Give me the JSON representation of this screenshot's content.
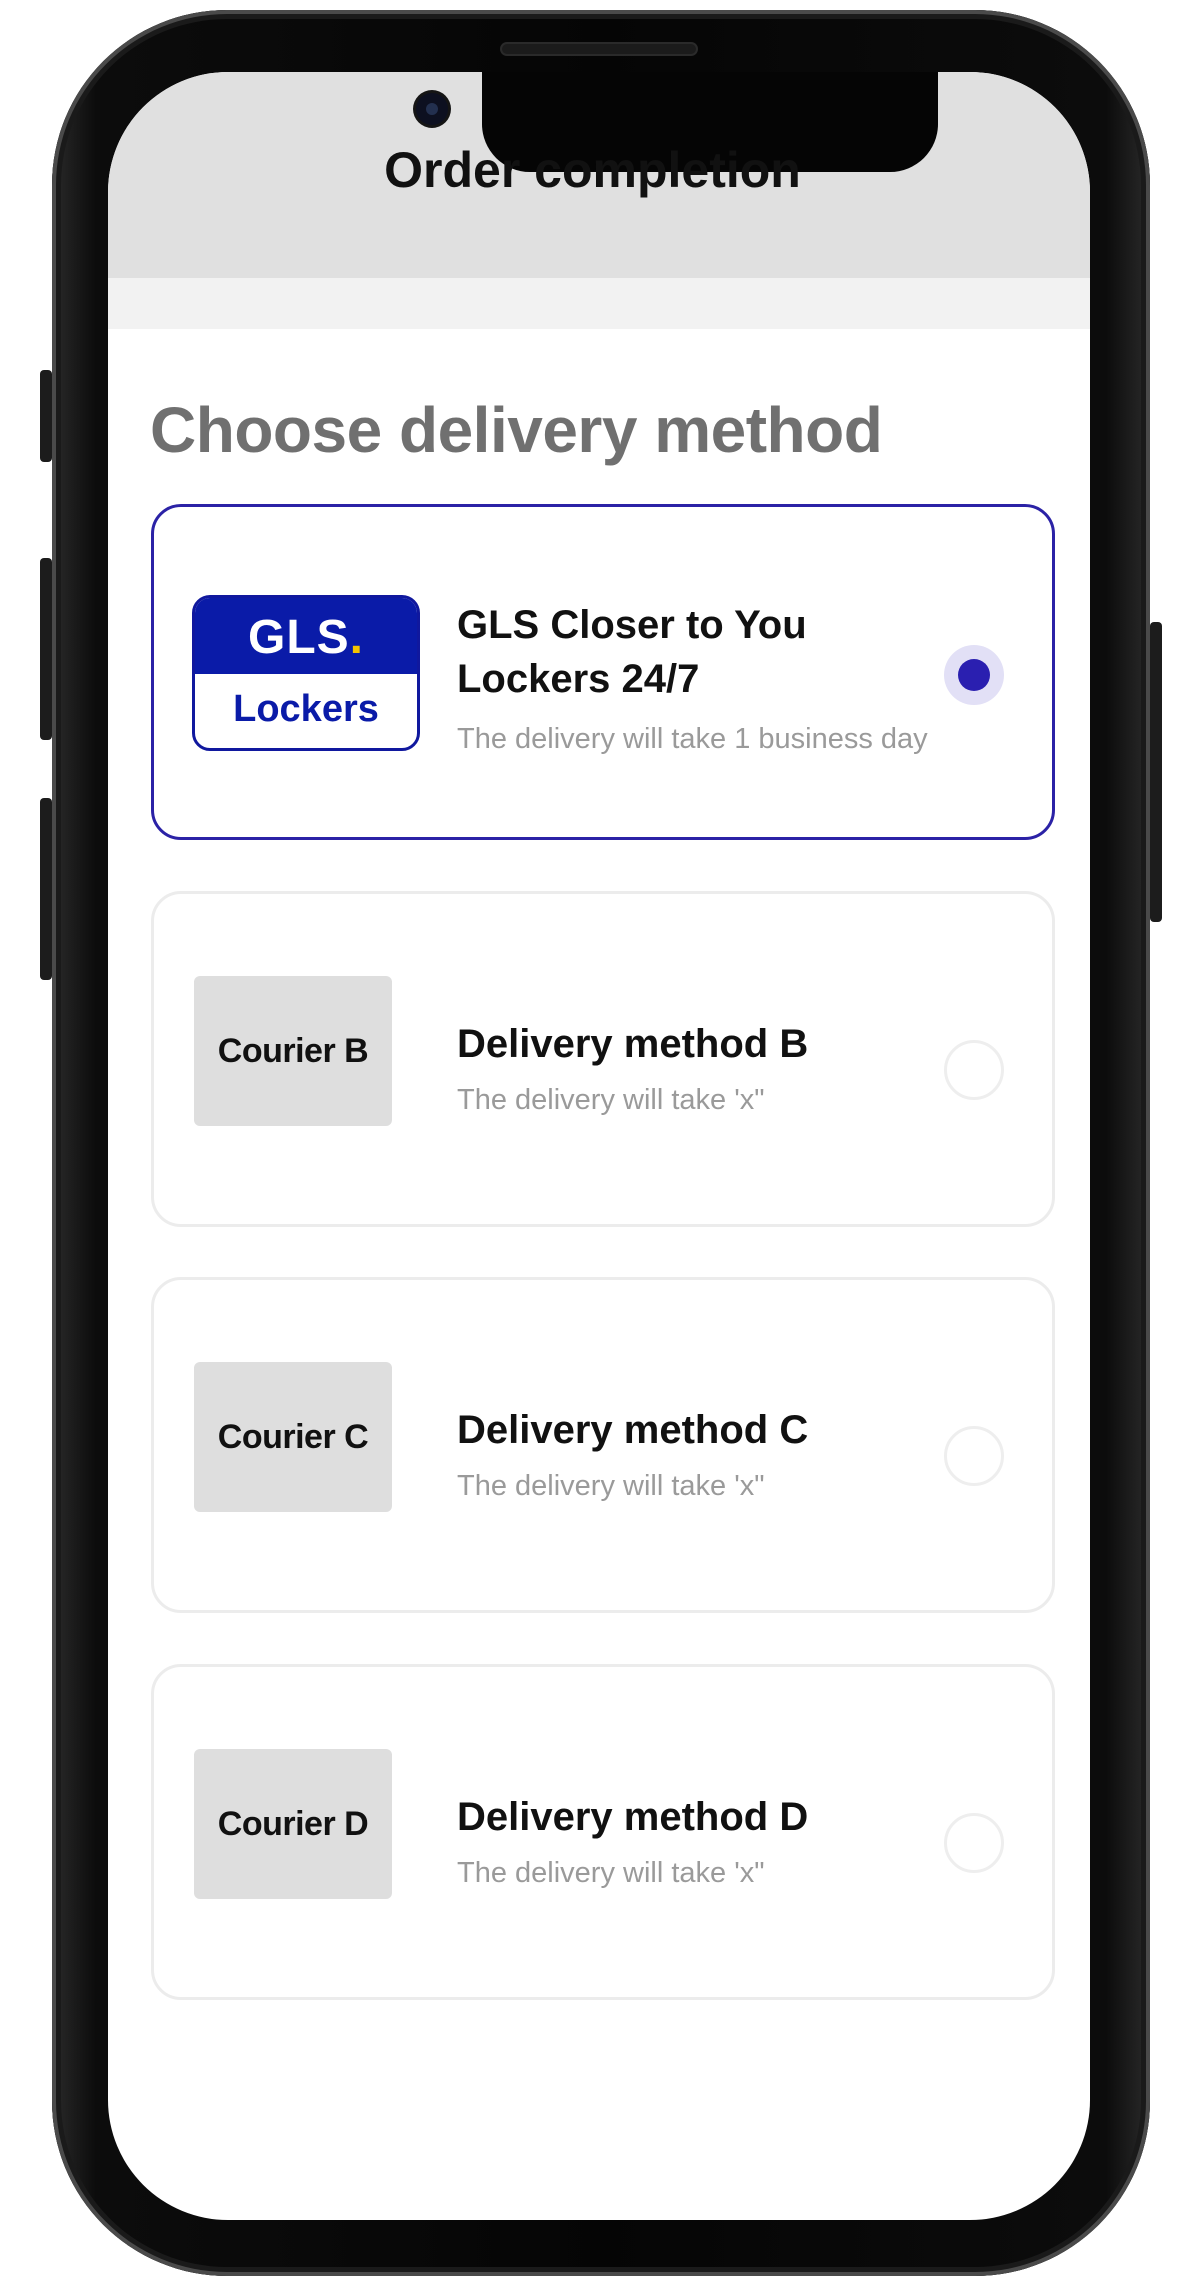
{
  "header": {
    "title": "Order completion"
  },
  "section": {
    "title": "Choose delivery method"
  },
  "options": [
    {
      "logo_top": "GLS",
      "logo_dot": ".",
      "logo_bottom": "Lockers",
      "title_line1": "GLS Closer to You",
      "title_line2": "Lockers 24/7",
      "description": "The delivery will take 1 business day",
      "selected": true
    },
    {
      "logo": "Courier B",
      "title": "Delivery method B",
      "description": "The delivery will take 'x\"",
      "selected": false
    },
    {
      "logo": "Courier C",
      "title": "Delivery method C",
      "description": "The delivery will take 'x\"",
      "selected": false
    },
    {
      "logo": "Courier D",
      "title": "Delivery method D",
      "description": "The delivery will take 'x\"",
      "selected": false
    }
  ],
  "colors": {
    "accent": "#2a1fb0",
    "gls_blue": "#0a1ba8",
    "gls_yellow": "#f5c400",
    "header_bg": "#e0e0e0"
  }
}
